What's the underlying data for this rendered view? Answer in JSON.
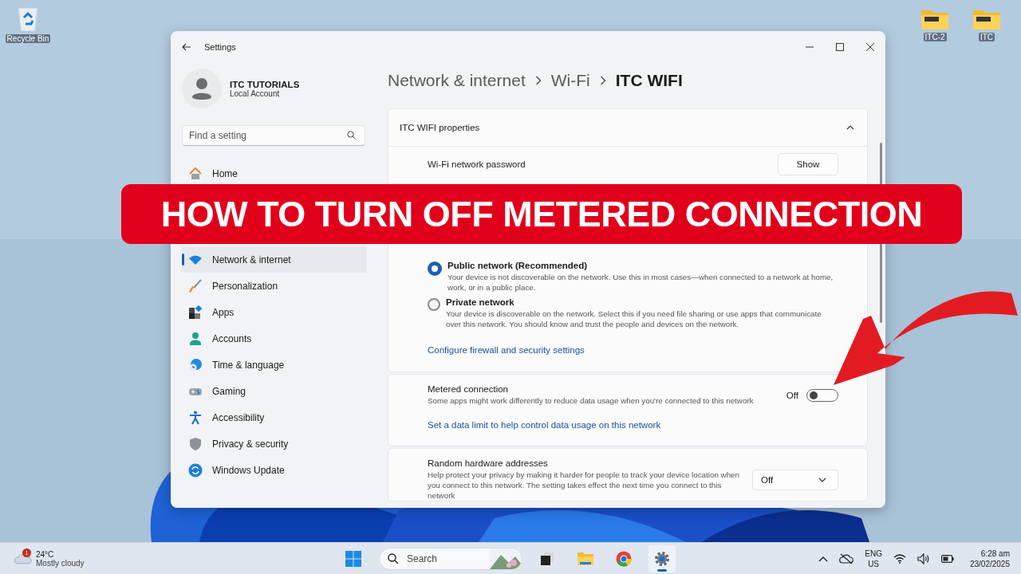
{
  "desktop_icons": [
    {
      "label": "Recycle Bin",
      "kind": "bin"
    },
    {
      "label": "ITC-2",
      "kind": "folder"
    },
    {
      "label": "ITC",
      "kind": "folder"
    }
  ],
  "window": {
    "title": "Settings"
  },
  "account": {
    "name": "ITC TUTORIALS",
    "type": "Local Account"
  },
  "search": {
    "placeholder": "Find a setting"
  },
  "sidebar": {
    "items": [
      {
        "label": "Home",
        "kind": "home",
        "selected": false
      },
      {
        "label": "Network & internet",
        "kind": "wifi",
        "selected": true
      },
      {
        "label": "Personalization",
        "kind": "brush",
        "selected": false
      },
      {
        "label": "Apps",
        "kind": "apps",
        "selected": false
      },
      {
        "label": "Accounts",
        "kind": "accounts",
        "selected": false
      },
      {
        "label": "Time & language",
        "kind": "time",
        "selected": false
      },
      {
        "label": "Gaming",
        "kind": "gaming",
        "selected": false
      },
      {
        "label": "Accessibility",
        "kind": "accessibility",
        "selected": false
      },
      {
        "label": "Privacy & security",
        "kind": "privacy",
        "selected": false
      },
      {
        "label": "Windows Update",
        "kind": "update",
        "selected": false
      }
    ]
  },
  "breadcrumb": [
    "Network & internet",
    "Wi-Fi",
    "ITC WIFI"
  ],
  "properties": {
    "title": "ITC WIFI properties",
    "expanded": true,
    "password_label": "Wi-Fi network password",
    "show_button": "Show",
    "profiles": [
      {
        "label": "Public network (Recommended)",
        "description": "Your device is not discoverable on the network. Use this in most cases—when connected to a network at home, work, or in a public place.",
        "selected": true
      },
      {
        "label": "Private network",
        "description": "Your device is discoverable on the network. Select this if you need file sharing or use apps that communicate over this network. You should know and trust the people and devices on the network.",
        "selected": false
      }
    ],
    "firewall_link": "Configure firewall and security settings"
  },
  "metered": {
    "title": "Metered connection",
    "description": "Some apps might work differently to reduce data usage when you're connected to this network",
    "state": "Off",
    "on": false,
    "link": "Set a data limit to help control data usage on this network"
  },
  "random_hw": {
    "title": "Random hardware addresses",
    "description": "Help protect your privacy by making it harder for people to track your device location when you connect to this network. The setting takes effect the next time you connect to this network",
    "value": "Off"
  },
  "banner": "HOW TO TURN OFF METERED CONNECTION",
  "taskbar": {
    "weather": {
      "badge": "1",
      "temp": "24°C",
      "condition": "Mostly cloudy"
    },
    "search": "Search",
    "apps": [
      {
        "kind": "taskview",
        "selected": false
      },
      {
        "kind": "explorer",
        "selected": false
      },
      {
        "kind": "chrome",
        "selected": false
      },
      {
        "kind": "settings",
        "selected": true
      }
    ],
    "language": "ENG",
    "region": "US",
    "time": "6:28 am",
    "date": "23/02/2025"
  }
}
